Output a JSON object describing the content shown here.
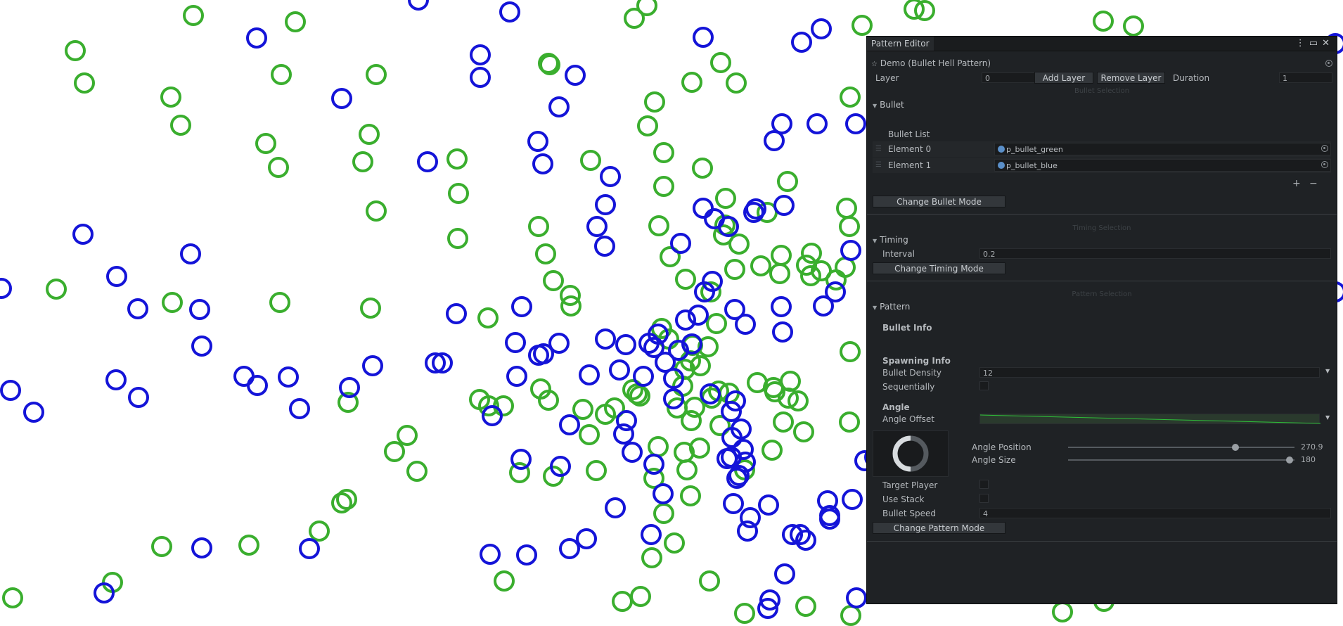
{
  "window": {
    "tab_title": "Pattern Editor",
    "icons": [
      "kebab-menu-icon",
      "maximize-icon",
      "close-icon"
    ]
  },
  "header": {
    "asset_label": "Demo (Bullet Hell Pattern)"
  },
  "layer_row": {
    "layer_label": "Layer",
    "layer_value": "0",
    "add_layer": "Add Layer",
    "remove_layer": "Remove Layer",
    "duration_label": "Duration",
    "duration_value": "1"
  },
  "bullet_section": {
    "section_title": "Bullet Selection",
    "foldout": "Bullet",
    "list_label": "Bullet List",
    "elements": [
      {
        "label": "Element 0",
        "value": "p_bullet_green"
      },
      {
        "label": "Element 1",
        "value": "p_bullet_blue"
      }
    ],
    "add": "+",
    "remove": "−",
    "change_mode": "Change Bullet Mode"
  },
  "timing_section": {
    "section_title": "Timing Selection",
    "foldout": "Timing",
    "interval_label": "Interval",
    "interval_value": "0.2",
    "change_mode": "Change Timing Mode"
  },
  "pattern_section": {
    "section_title": "Pattern Selection",
    "foldout": "Pattern",
    "bullet_info": "Bullet Info",
    "spawning_info": "Spawning Info",
    "density_label": "Bullet Density",
    "density_value": "12",
    "sequentially_label": "Sequentially",
    "angle_header": "Angle",
    "angle_offset_label": "Angle Offset",
    "angle_position_label": "Angle Position",
    "angle_position_value": "270.9",
    "angle_size_label": "Angle Size",
    "angle_size_value": "180",
    "target_player_label": "Target Player",
    "use_stack_label": "Use Stack",
    "speed_label": "Bullet Speed",
    "speed_value": "4",
    "change_mode": "Change Pattern Mode"
  },
  "colors": {
    "bullet_green": "#3aae2e",
    "bullet_blue": "#1414d8",
    "panel_bg": "#1f2225"
  }
}
